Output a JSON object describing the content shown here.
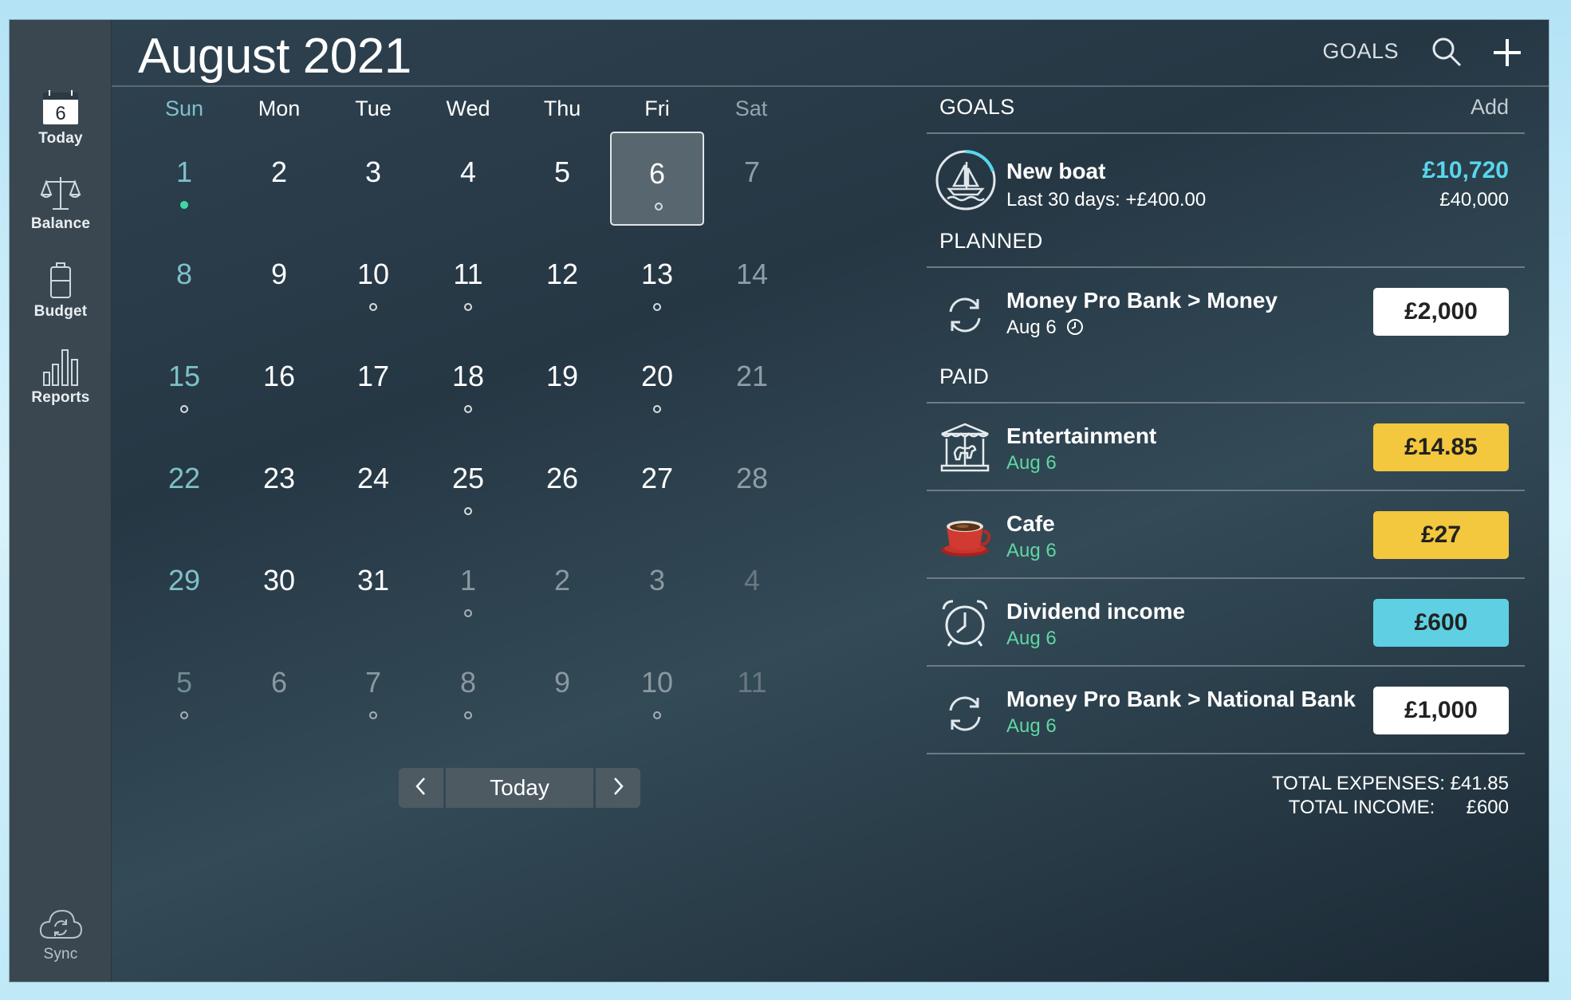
{
  "colors": {
    "window_bg": "#2a3b47",
    "sidebar_bg": "#3a4750",
    "accent_teal": "#58d6ec",
    "paid_green": "#5fd7a4",
    "chip_yellow": "#f3c73e",
    "chip_cyan": "#5fd0e3",
    "chip_white": "#ffffff"
  },
  "header": {
    "month": "August",
    "year": "2021",
    "goals_link": "GOALS",
    "search_icon": "search-icon",
    "add_icon": "plus-icon"
  },
  "sidebar": {
    "items": [
      {
        "label": "Today",
        "icon": "calendar-icon",
        "badge": "6"
      },
      {
        "label": "Balance",
        "icon": "scale-icon"
      },
      {
        "label": "Budget",
        "icon": "battery-icon"
      },
      {
        "label": "Reports",
        "icon": "bar-chart-icon"
      }
    ],
    "sync": {
      "label": "Sync",
      "icon": "cloud-sync-icon"
    }
  },
  "calendar": {
    "weekdays": [
      "Sun",
      "Mon",
      "Tue",
      "Wed",
      "Thu",
      "Fri",
      "Sat"
    ],
    "selected_day": "6",
    "weeks": [
      [
        {
          "d": "1",
          "m": "cur",
          "dot": "fill"
        },
        {
          "d": "2",
          "m": "cur"
        },
        {
          "d": "3",
          "m": "cur"
        },
        {
          "d": "4",
          "m": "cur"
        },
        {
          "d": "5",
          "m": "cur"
        },
        {
          "d": "6",
          "m": "cur",
          "dot": "ring",
          "sel": true
        },
        {
          "d": "7",
          "m": "cur"
        }
      ],
      [
        {
          "d": "8",
          "m": "cur"
        },
        {
          "d": "9",
          "m": "cur"
        },
        {
          "d": "10",
          "m": "cur",
          "dot": "ring"
        },
        {
          "d": "11",
          "m": "cur",
          "dot": "ring"
        },
        {
          "d": "12",
          "m": "cur"
        },
        {
          "d": "13",
          "m": "cur",
          "dot": "ring"
        },
        {
          "d": "14",
          "m": "cur"
        }
      ],
      [
        {
          "d": "15",
          "m": "cur",
          "dot": "ring"
        },
        {
          "d": "16",
          "m": "cur"
        },
        {
          "d": "17",
          "m": "cur"
        },
        {
          "d": "18",
          "m": "cur",
          "dot": "ring"
        },
        {
          "d": "19",
          "m": "cur"
        },
        {
          "d": "20",
          "m": "cur",
          "dot": "ring"
        },
        {
          "d": "21",
          "m": "cur"
        }
      ],
      [
        {
          "d": "22",
          "m": "cur"
        },
        {
          "d": "23",
          "m": "cur"
        },
        {
          "d": "24",
          "m": "cur"
        },
        {
          "d": "25",
          "m": "cur",
          "dot": "ring"
        },
        {
          "d": "26",
          "m": "cur"
        },
        {
          "d": "27",
          "m": "cur"
        },
        {
          "d": "28",
          "m": "cur"
        }
      ],
      [
        {
          "d": "29",
          "m": "cur"
        },
        {
          "d": "30",
          "m": "cur"
        },
        {
          "d": "31",
          "m": "cur"
        },
        {
          "d": "1",
          "m": "next",
          "dot": "ring"
        },
        {
          "d": "2",
          "m": "next"
        },
        {
          "d": "3",
          "m": "next"
        },
        {
          "d": "4",
          "m": "next"
        }
      ],
      [
        {
          "d": "5",
          "m": "next",
          "dot": "ring"
        },
        {
          "d": "6",
          "m": "next"
        },
        {
          "d": "7",
          "m": "next",
          "dot": "ring"
        },
        {
          "d": "8",
          "m": "next",
          "dot": "ring"
        },
        {
          "d": "9",
          "m": "next"
        },
        {
          "d": "10",
          "m": "next",
          "dot": "ring"
        },
        {
          "d": "11",
          "m": "next"
        }
      ]
    ],
    "nav": {
      "prev_icon": "chevron-left-icon",
      "today_label": "Today",
      "next_icon": "chevron-right-icon"
    }
  },
  "panel": {
    "goals": {
      "heading": "GOALS",
      "add_label": "Add",
      "item": {
        "icon": "sailboat-icon",
        "title": "New boat",
        "subtitle": "Last 30 days: +£400.00",
        "amount": "£10,720",
        "target": "£40,000"
      }
    },
    "planned": {
      "heading": "PLANNED",
      "items": [
        {
          "icon": "repeat-icon",
          "title": "Money Pro Bank > Money",
          "date": "Aug 6",
          "date_icon": "clock-icon",
          "amount": "£2,000",
          "chip": "white"
        }
      ]
    },
    "paid": {
      "heading": "PAID",
      "items": [
        {
          "icon": "carousel-icon",
          "title": "Entertainment",
          "date": "Aug 6",
          "amount": "£14.85",
          "chip": "yellow"
        },
        {
          "icon": "coffee-cup-icon",
          "title": "Cafe",
          "date": "Aug 6",
          "amount": "£27",
          "chip": "yellow"
        },
        {
          "icon": "alarm-clock-icon",
          "title": "Dividend income",
          "date": "Aug 6",
          "amount": "£600",
          "chip": "cyan"
        },
        {
          "icon": "repeat-icon",
          "title": "Money Pro Bank > National Bank",
          "date": "Aug 6",
          "amount": "£1,000",
          "chip": "white"
        }
      ]
    },
    "totals": {
      "expenses_label": "TOTAL EXPENSES:",
      "expenses_value": "£41.85",
      "income_label": "TOTAL INCOME:",
      "income_value": "£600"
    }
  }
}
